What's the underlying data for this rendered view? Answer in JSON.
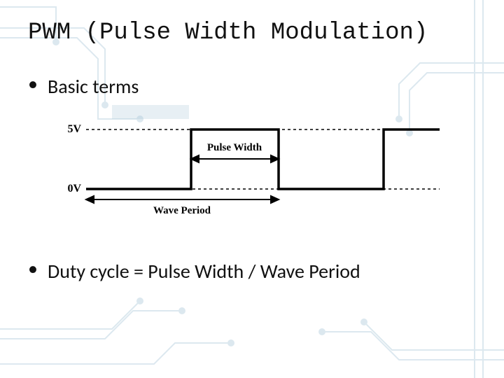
{
  "title": "PWM (Pulse Width Modulation)",
  "bullets": {
    "basic_terms": "Basic terms",
    "duty_cycle": "Duty cycle = Pulse Width / Wave Period"
  },
  "diagram": {
    "label_5v": "5V",
    "label_0v": "0V",
    "label_pulse_width": "Pulse Width",
    "label_wave_period": "Wave Period"
  },
  "colors": {
    "text": "#111111",
    "diagram_stroke": "#000000",
    "circuit_trace": "#cfe0ea",
    "circuit_trace_strong": "#9fbfd4"
  }
}
